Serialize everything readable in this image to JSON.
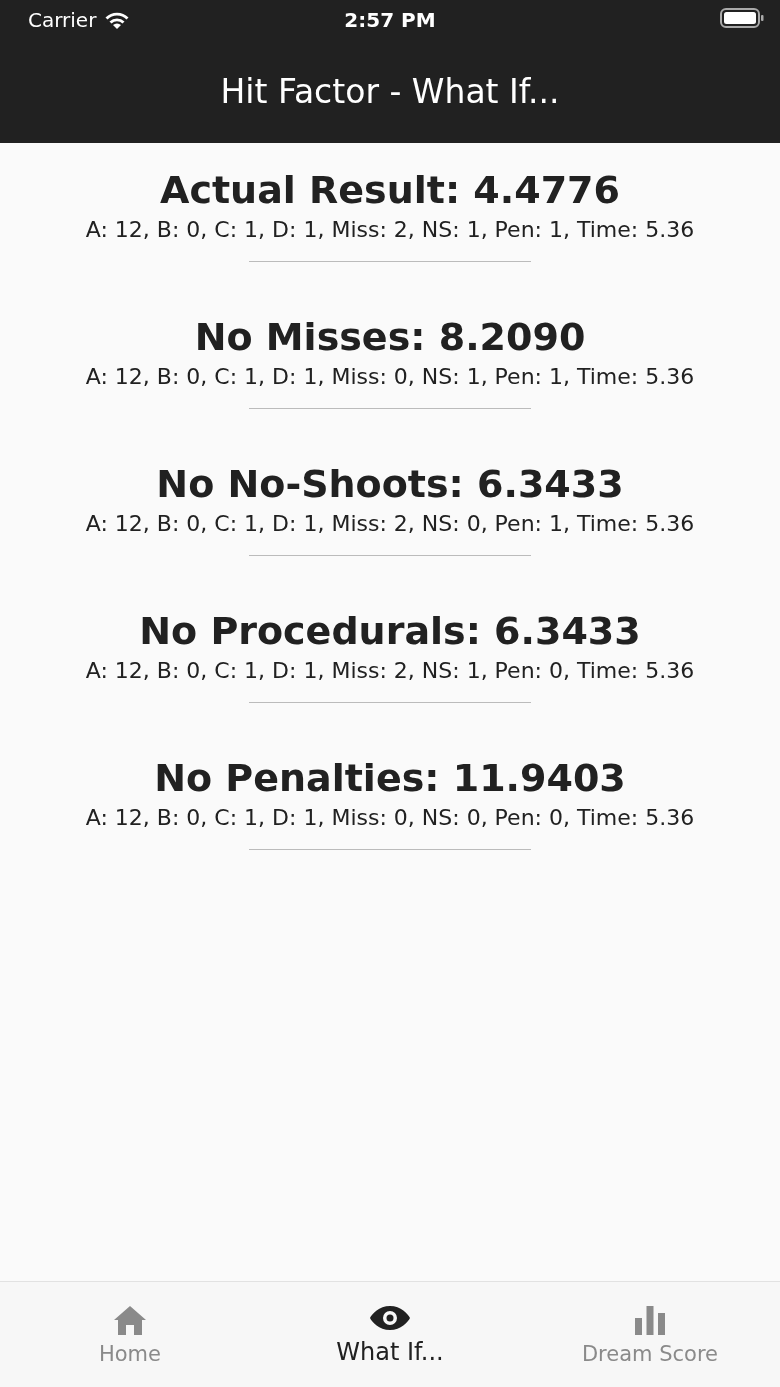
{
  "status_bar": {
    "carrier": "Carrier",
    "time": "2:57 PM"
  },
  "nav_bar": {
    "title": "Hit Factor - What If..."
  },
  "results": [
    {
      "title": "Actual Result: 4.4776",
      "detail": "A: 12, B: 0, C: 1, D: 1, Miss: 2, NS: 1, Pen: 1, Time: 5.36"
    },
    {
      "title": "No Misses: 8.2090",
      "detail": "A: 12, B: 0, C: 1, D: 1, Miss: 0, NS: 1, Pen: 1, Time: 5.36"
    },
    {
      "title": "No No-Shoots: 6.3433",
      "detail": "A: 12, B: 0, C: 1, D: 1, Miss: 2, NS: 0, Pen: 1, Time: 5.36"
    },
    {
      "title": "No Procedurals: 6.3433",
      "detail": "A: 12, B: 0, C: 1, D: 1, Miss: 2, NS: 1, Pen: 0, Time: 5.36"
    },
    {
      "title": "No Penalties: 11.9403",
      "detail": "A: 12, B: 0, C: 1, D: 1, Miss: 0, NS: 0, Pen: 0, Time: 5.36"
    }
  ],
  "tab_bar": [
    {
      "kind": "home",
      "label": "Home",
      "selected": false
    },
    {
      "kind": "eye",
      "label": "What If...",
      "selected": true
    },
    {
      "kind": "chart",
      "label": "Dream Score",
      "selected": false
    }
  ]
}
